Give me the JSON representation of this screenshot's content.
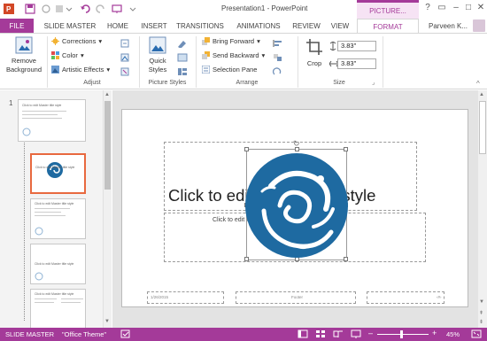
{
  "window": {
    "app_title": "Presentation1 - PowerPoint",
    "contextual_tab_title": "PICTURE...",
    "user": "Parveen K..."
  },
  "tabs": [
    {
      "label": "FILE"
    },
    {
      "label": "SLIDE MASTER"
    },
    {
      "label": "HOME"
    },
    {
      "label": "INSERT"
    },
    {
      "label": "TRANSITIONS"
    },
    {
      "label": "ANIMATIONS"
    },
    {
      "label": "REVIEW"
    },
    {
      "label": "VIEW"
    },
    {
      "label": "FORMAT"
    }
  ],
  "ribbon": {
    "remove_background": {
      "line1": "Remove",
      "line2": "Background"
    },
    "adjust": {
      "corrections": "Corrections",
      "color": "Color",
      "artistic_effects": "Artistic Effects",
      "label": "Adjust"
    },
    "picture_styles": {
      "quick_styles_line1": "Quick",
      "quick_styles_line2": "Styles",
      "label": "Picture Styles"
    },
    "arrange": {
      "bring_forward": "Bring Forward",
      "send_backward": "Send Backward",
      "selection_pane": "Selection Pane",
      "label": "Arrange"
    },
    "size": {
      "crop": "Crop",
      "height": "3.83\"",
      "width": "3.83\"",
      "label": "Size"
    }
  },
  "thumbnails": [
    {
      "number": "1",
      "text": "Click to edit Master title style"
    },
    {
      "text": "Click to edit Master title style"
    },
    {
      "text": "Click to edit Master title style"
    },
    {
      "text": "Click to edit Master title style"
    },
    {
      "text": "Click to edit Master title style"
    }
  ],
  "slide": {
    "title": "Click to edit Master title style",
    "subtitle": "Click to edit Master subtitle style",
    "footer_date": "1/26/2015",
    "footer_text": "Footer",
    "footer_num": "‹#›"
  },
  "status": {
    "view": "SLIDE MASTER",
    "theme": "\"Office Theme\"",
    "zoom": "45%"
  },
  "colors": {
    "accent": "#a43a99",
    "logo_blue": "#1e6aa1",
    "selected_thumb_border": "#e8693f"
  },
  "icons": [
    "save-icon",
    "undo-icon",
    "redo-icon",
    "slideshow-icon",
    "remove-background-icon",
    "corrections-icon",
    "color-icon",
    "artistic-effects-icon",
    "quick-styles-icon",
    "bring-forward-icon",
    "send-backward-icon",
    "selection-pane-icon",
    "crop-icon",
    "height-icon",
    "width-icon",
    "normal-view-icon",
    "slide-sorter-icon",
    "reading-view-icon",
    "fit-to-window-icon"
  ]
}
